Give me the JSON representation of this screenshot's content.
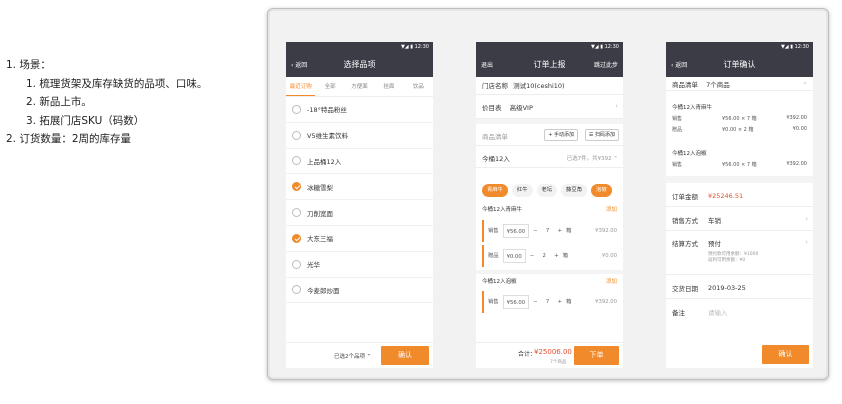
{
  "notes": {
    "item1": "1.  场景：",
    "item1_1": "1.  梳理货架及库存缺货的品项、口味。",
    "item1_2": "2.  新品上市。",
    "item1_3": "3.  拓展门店SKU（码数）",
    "item2": "2.  订货数量：2周的库存量"
  },
  "status": {
    "time": "12:30",
    "icons": "▼◢ ▮"
  },
  "phone1": {
    "back": "‹ 返回",
    "title": "选择品项",
    "tabs": [
      "最近订购",
      "全部",
      "方便面",
      "挂面",
      "饮品"
    ],
    "items": [
      {
        "label": "-18°特品粉丝",
        "checked": false
      },
      {
        "label": "V5维生素饮料",
        "checked": false
      },
      {
        "label": "上品桶12入",
        "checked": false
      },
      {
        "label": "冰糖雪梨",
        "checked": true
      },
      {
        "label": "刀削宽面",
        "checked": false
      },
      {
        "label": "大东三福",
        "checked": true
      },
      {
        "label": "光华",
        "checked": false
      },
      {
        "label": "今麦郎炒面",
        "checked": false
      }
    ],
    "selected_text": "已选2个品项 ⌃",
    "confirm": "确认"
  },
  "phone2": {
    "back": "退出",
    "title": "订单上报",
    "skip": "跳过此步",
    "store_label": "门店名称",
    "store_value": "测试10(ceshi10)",
    "price_label": "价目表",
    "price_value": "高级VIP",
    "list_label": "商品清单",
    "manual_add": "+ 手动添加",
    "scan_add": "扫码添加",
    "group_name": "今桶12入",
    "group_info": "已选7件，共¥392 ⌃",
    "chips": [
      "青麻牛",
      "红牛",
      "老坛",
      "藤豆角",
      "泡椒"
    ],
    "sub1_title": "今桶12入青麻牛",
    "sub1_add": "添加",
    "lines1": [
      {
        "type": "销售",
        "price": "¥56.00",
        "qty": "7",
        "unit": "箱",
        "total": "¥392.00"
      },
      {
        "type": "赠品",
        "price": "¥0.00",
        "qty": "2",
        "unit": "箱",
        "total": "¥0.00"
      }
    ],
    "sub2_title": "今桶12入泡椒",
    "sub2_add": "添加",
    "lines2": [
      {
        "type": "销售",
        "price": "¥56.00",
        "qty": "7",
        "unit": "箱",
        "total": "¥392.00"
      }
    ],
    "total_label": "合计：",
    "total_value": "¥25006.00",
    "total_sub": "7个商品",
    "submit": "下单"
  },
  "phone3": {
    "back": "‹ 返回",
    "title": "订单确认",
    "list_label": "商品清单",
    "list_value": "7个商品",
    "group1_title": "今桶12入青麻牛",
    "group1_lines": [
      {
        "type": "销售",
        "detail": "¥56.00 × 7 箱",
        "total": "¥392.00"
      },
      {
        "type": "赠品",
        "detail": "¥0.00 × 2 箱",
        "total": "¥0.00"
      }
    ],
    "group2_title": "今桶12入泡椒",
    "group2_lines": [
      {
        "type": "销售",
        "detail": "¥56.00 × 7 箱",
        "total": "¥392.00"
      }
    ],
    "amount_label": "订单金额",
    "amount_value": "¥25246.51",
    "sale_label": "销售方式",
    "sale_value": "车销",
    "settle_label": "结算方式",
    "settle_value": "预付",
    "settle_note1": "预付款可用余额：¥1000",
    "settle_note2": "返利可用余额：¥0",
    "date_label": "交货日期",
    "date_value": "2019-03-25",
    "remark_label": "备注",
    "remark_placeholder": "请输入",
    "confirm": "确认"
  },
  "colors": {
    "accent": "#f08a2a",
    "header": "#3c3c46",
    "price_red": "#e4502e"
  }
}
